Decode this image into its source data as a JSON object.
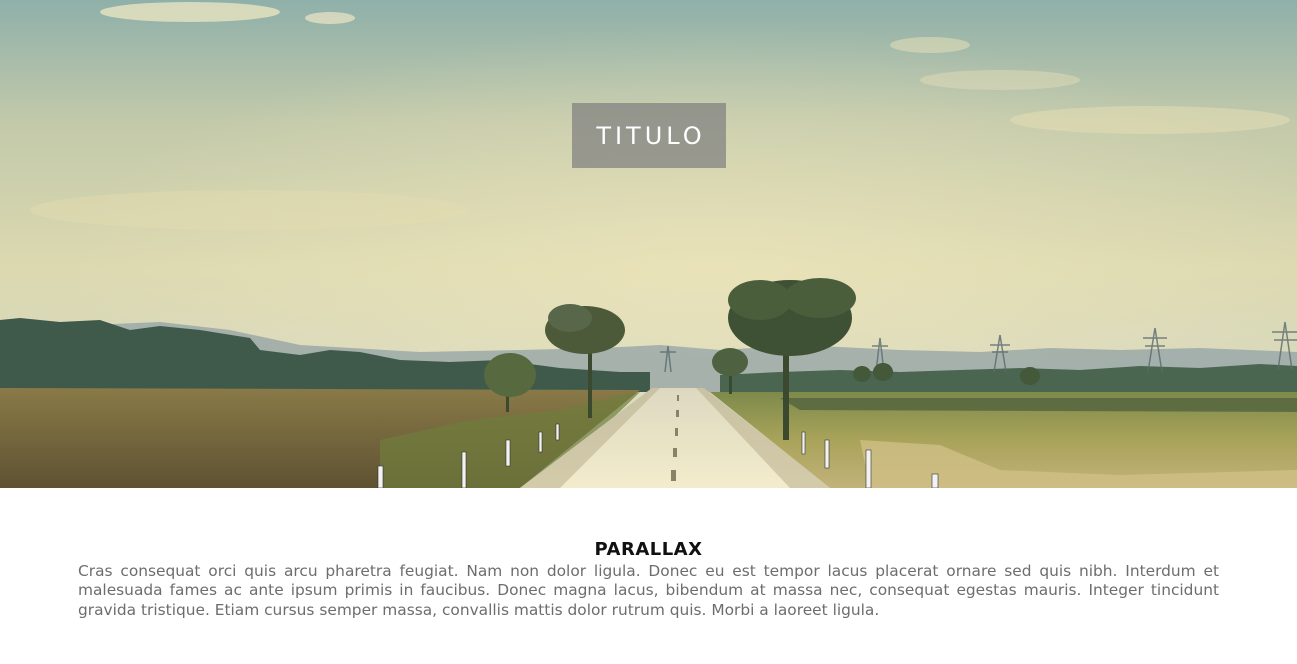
{
  "hero": {
    "title": "TITULO",
    "image": "road-through-fields-landscape",
    "colors": {
      "sky_top": "#8fb2ad",
      "sky_bottom": "#e2dfb4",
      "field_left": "#7a6a3c",
      "field_right": "#a8a455",
      "road": "#f0ebcf",
      "title_box": "#8a8a8a"
    }
  },
  "section": {
    "title": "PARALLAX",
    "text": "Cras consequat orci quis arcu pharetra feugiat. Nam non dolor ligula. Donec eu est tempor lacus placerat ornare sed quis nibh. Interdum et malesuada fames ac ante ipsum primis in faucibus. Donec magna lacus, bibendum at massa nec, consequat egestas mauris. Integer tincidunt gravida tristique. Etiam cursus semper massa, convallis mattis dolor rutrum quis. Morbi a laoreet ligula."
  }
}
